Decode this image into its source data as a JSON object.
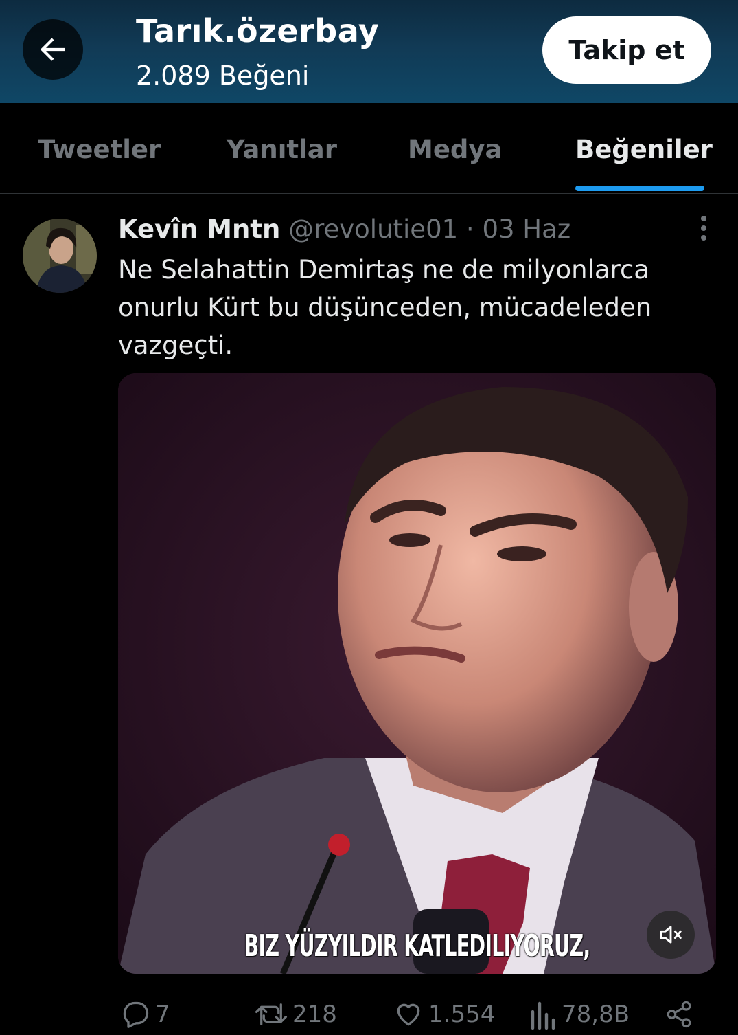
{
  "header": {
    "profile_name": "Tarık.özerbay",
    "likes_count": "2.089 Beğeni",
    "follow_label": "Takip et"
  },
  "tabs": [
    {
      "label": "Tweetler",
      "active": false
    },
    {
      "label": "Yanıtlar",
      "active": false
    },
    {
      "label": "Medya",
      "active": false
    },
    {
      "label": "Beğeniler",
      "active": true
    }
  ],
  "tweet": {
    "author_name": "Kevîn Mntn",
    "handle": "@revolutie01",
    "separator": "·",
    "date": "03 Haz",
    "text": "Ne Selahattin Demirtaş ne de milyonlarca onurlu Kürt bu düşünceden, mücadeleden vazgeçti.",
    "media": {
      "caption": "BIZ YÜZYILDIR KATLEDILIYORUZ,"
    },
    "actions": {
      "replies": "7",
      "retweets": "218",
      "likes": "1.554",
      "views": "78,8B"
    }
  },
  "colors": {
    "accent": "#1d9bf0",
    "secondary_text": "#71767b",
    "background": "#000000"
  },
  "icons": [
    "arrow-left-icon",
    "more-vertical-icon",
    "mute-icon",
    "reply-icon",
    "retweet-icon",
    "like-icon",
    "views-icon",
    "share-icon"
  ]
}
